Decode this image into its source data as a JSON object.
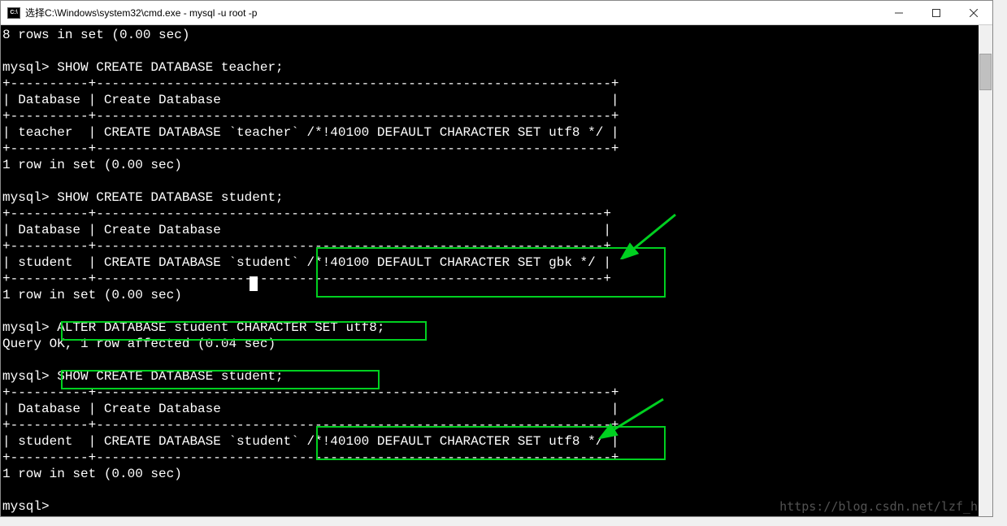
{
  "titlebar": {
    "icon_label": "C:\\",
    "title": "选择C:\\Windows\\system32\\cmd.exe - mysql  -u root -p"
  },
  "terminal": {
    "line01": "8 rows in set (0.00 sec)",
    "line02": "",
    "line03": "mysql> SHOW CREATE DATABASE teacher;",
    "line04": "+----------+------------------------------------------------------------------+",
    "line05": "| Database | Create Database                                                  |",
    "line06": "+----------+------------------------------------------------------------------+",
    "line07": "| teacher  | CREATE DATABASE `teacher` /*!40100 DEFAULT CHARACTER SET utf8 */ |",
    "line08": "+----------+------------------------------------------------------------------+",
    "line09": "1 row in set (0.00 sec)",
    "line10": "",
    "line11": "mysql> SHOW CREATE DATABASE student;",
    "line12": "+----------+-----------------------------------------------------------------+",
    "line13": "| Database | Create Database                                                 |",
    "line14": "+----------+-----------------------------------------------------------------+",
    "line15": "| student  | CREATE DATABASE `student` /*!40100 DEFAULT CHARACTER SET gbk */ |",
    "line16": "+----------+-----------------------------------------------------------------+",
    "line17": "1 row in set (0.00 sec)",
    "line18": "",
    "line19": "mysql> ALTER DATABASE student CHARACTER SET utf8;",
    "line20": "Query OK, 1 row affected (0.04 sec)",
    "line21": "",
    "line22": "mysql> SHOW CREATE DATABASE student;",
    "line23": "+----------+------------------------------------------------------------------+",
    "line24": "| Database | Create Database                                                  |",
    "line25": "+----------+------------------------------------------------------------------+",
    "line26": "| student  | CREATE DATABASE `student` /*!40100 DEFAULT CHARACTER SET utf8 */ |",
    "line27": "+----------+------------------------------------------------------------------+",
    "line28": "1 row in set (0.00 sec)",
    "line29": "",
    "line30": "mysql>"
  },
  "watermark": "https://blog.csdn.net/lzf_h",
  "annotations": {
    "box1_desc": "highlight gbk charset",
    "box2_desc": "highlight ALTER DATABASE command",
    "box3_desc": "highlight SHOW CREATE after alter",
    "box4_desc": "highlight utf8 charset after alter"
  }
}
